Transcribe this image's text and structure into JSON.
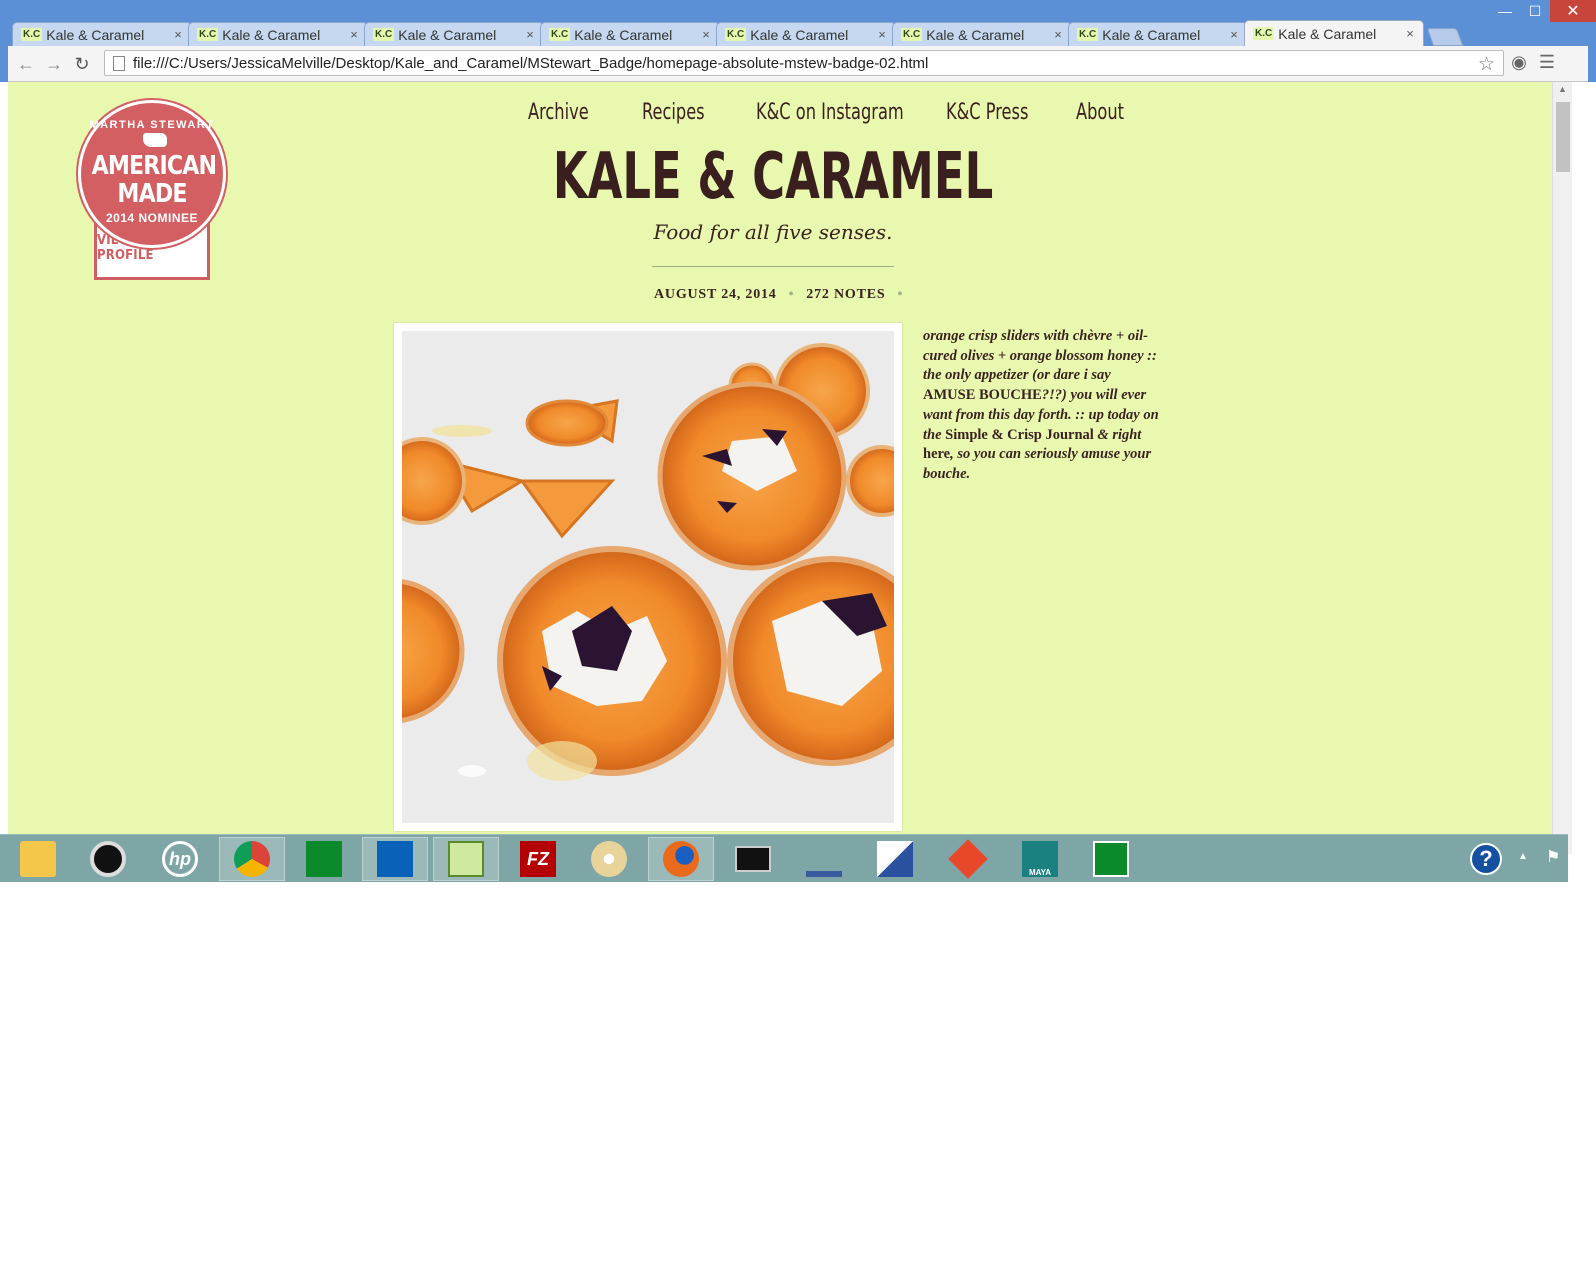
{
  "browser": {
    "tabs": [
      {
        "favicon": "K.C",
        "title": "Kale & Caramel",
        "active": false
      },
      {
        "favicon": "K.C",
        "title": "Kale & Caramel",
        "active": false
      },
      {
        "favicon": "K.C",
        "title": "Kale & Caramel",
        "active": false
      },
      {
        "favicon": "K.C",
        "title": "Kale & Caramel",
        "active": false
      },
      {
        "favicon": "K.C",
        "title": "Kale & Caramel",
        "active": false
      },
      {
        "favicon": "K.C",
        "title": "Kale & Caramel",
        "active": false
      },
      {
        "favicon": "K.C",
        "title": "Kale & Caramel",
        "active": false
      },
      {
        "favicon": "K.C",
        "title": "Kale & Caramel",
        "active": true
      }
    ],
    "tab_close_glyph": "×",
    "url": "file:///C:/Users/JessicaMelville/Desktop/Kale_and_Caramel/MStewart_Badge/homepage-absolute-mstew-badge-02.html",
    "window_controls": {
      "minimize": "—",
      "maximize": "☐",
      "close": "✕"
    }
  },
  "badge": {
    "top_arc": "MARTHA STEWART",
    "line1": "AMERICAN",
    "line2": "MADE",
    "bottom_arc": "2014 NOMINEE",
    "ribbon": "VIEW MY PROFILE",
    "color": "#cf5d62"
  },
  "site": {
    "nav": [
      "Archive",
      "Recipes",
      "K&C on Instagram",
      "K&C Press",
      "About"
    ],
    "title": "KALE & CARAMEL",
    "tagline": "Food for all five senses.",
    "background": "#e8f8ae",
    "text_color": "#3a2222"
  },
  "post": {
    "date": "AUGUST 24, 2014",
    "notes": "272 NOTES",
    "caption": {
      "part1": "orange crisp sliders with chèvre + oil-cured olives + orange blossom honey :: the only appetizer (or dare i say ",
      "amuse": "AMUSE BOUCHE",
      "part2": "?!?) you will ever want from this day forth. :: up today on the ",
      "link1": "Simple & Crisp Journal",
      "part3": " & right ",
      "link2": "here",
      "part4": ", so you can seriously amuse your bouche."
    }
  },
  "taskbar": {
    "apps": [
      {
        "icon": "file-explorer-icon",
        "running": false
      },
      {
        "icon": "webcam-icon",
        "running": false
      },
      {
        "icon": "hp-icon",
        "label": "hp",
        "running": false
      },
      {
        "icon": "chrome-icon",
        "running": true
      },
      {
        "icon": "store-icon",
        "running": false
      },
      {
        "icon": "mail-icon",
        "running": true
      },
      {
        "icon": "notepad-icon",
        "running": true
      },
      {
        "icon": "filezilla-icon",
        "label": "FZ",
        "running": false
      },
      {
        "icon": "paint-icon",
        "running": false
      },
      {
        "icon": "firefox-icon",
        "running": true
      },
      {
        "icon": "terminal-icon",
        "running": false
      },
      {
        "icon": "network-icon",
        "running": false
      },
      {
        "icon": "remote-desktop-icon",
        "running": false
      },
      {
        "icon": "git-icon",
        "running": false
      },
      {
        "icon": "maya-icon",
        "label": "MAYA",
        "running": false
      },
      {
        "icon": "calculator-icon",
        "running": false
      }
    ],
    "help": "?"
  }
}
